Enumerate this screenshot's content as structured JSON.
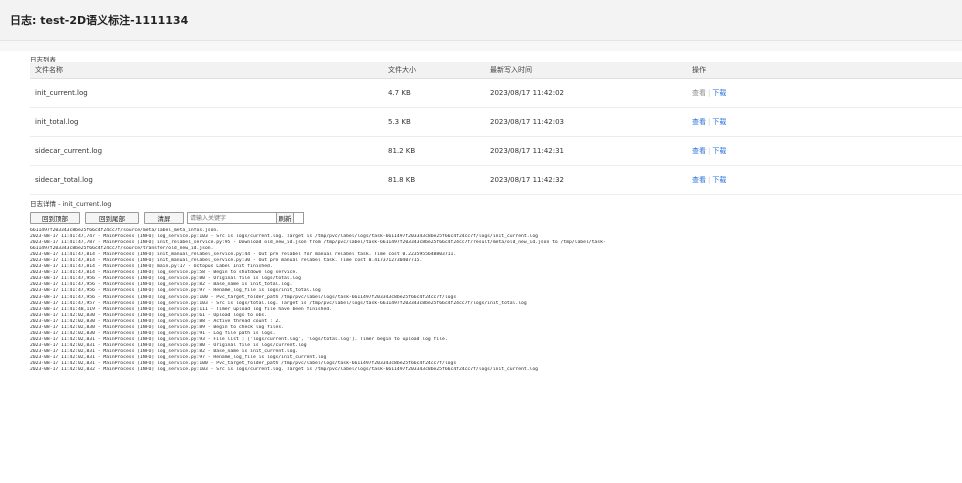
{
  "header": {
    "title": "日志: test-2D语义标注-1111134"
  },
  "log_list": {
    "label": "日志列表",
    "columns": [
      "文件名称",
      "文件大小",
      "最新写入时间",
      "操作"
    ],
    "rows": [
      {
        "name": "init_current.log",
        "size": "4.7 KB",
        "time": "2023/08/17 11:42:02",
        "view": "查看",
        "download": "下载"
      },
      {
        "name": "init_total.log",
        "size": "5.3 KB",
        "time": "2023/08/17 11:42:03",
        "view": "查看",
        "download": "下载"
      },
      {
        "name": "sidecar_current.log",
        "size": "81.2 KB",
        "time": "2023/08/17 11:42:31",
        "view": "查看",
        "download": "下载"
      },
      {
        "name": "sidecar_total.log",
        "size": "81.8 KB",
        "time": "2023/08/17 11:42:32",
        "view": "查看",
        "download": "下载"
      }
    ]
  },
  "log_detail": {
    "label": "日志详情 - init_current.log",
    "buttons": {
      "top": "回到顶部",
      "bottom": "回到尾部",
      "clear": "清屏",
      "refresh": "刷新"
    },
    "search_placeholder": "请输入关键字",
    "lines": [
      "6611497f203343c8be25f66c4f24cc7f/source/meta/label_meta_infos.json.",
      "2023-08-17 11:41:47,747 - MainProcess [INFO] log_service.py:103 - Src is logs/current.log. Target is /tmp/pvc/label/logs/task-6611497f203343c8be25f66c4f24cc7f/logs/init_current.log",
      "2023-08-17 11:41:47,787 - MainProcess [INFO] init_relabel_service.py:95 - Download old_new_id.json from /tmp/pvc/label/task-6611497f203343c8be25f66c4f24cc7f/result/meta/old_new_id.json to /tmp/label/task-",
      "6611497f203343c8be25f66c4f24cc7f/source/transfer/old_new_id.json.",
      "2023-08-17 11:41:47,814 - MainProcess [INFO] init_manual_relabel_service.py:44 - Out pre relabel for manual relabel task. Time cost 0.2235955648803711.",
      "2023-08-17 11:41:47,814 - MainProcess [INFO] init_manual_relabel_service.py:30 - Out pre manual relabel task. Time cost 0.4173712730407715.",
      "2023-08-17 11:41:47,814 - MainProcess [INFO] main.py:17 - Octopus Label Init finished.",
      "2023-08-17 11:41:47,814 - MainProcess [INFO] log_service.py:58 - Begin to shutdown log service.",
      "2023-08-17 11:41:47,956 - MainProcess [INFO] log_service.py:80 - Original file is logs/total.log",
      "2023-08-17 11:41:47,956 - MainProcess [INFO] log_service.py:82 - Base_name is init_total.log.",
      "2023-08-17 11:41:47,956 - MainProcess [INFO] log_service.py:97 - Rename_log_file is logs/init_total.log",
      "2023-08-17 11:41:47,956 - MainProcess [INFO] log_service.py:100 - Pvc_target_folder_path /tmp/pvc/label/logs/task-6611497f203343c8be25f66c4f24cc7f/logs",
      "2023-08-17 11:41:47,957 - MainProcess [INFO] log_service.py:103 - Src is logs/total.log. Target is /tmp/pvc/label/logs/task-6611497f203343c8be25f66c4f24cc7f/logs/init_total.log",
      "2023-08-17 11:41:48,119 - MainProcess [INFO] log_service.py:111 - Timer upload log file have been finished.",
      "2023-08-17 11:42:02,830 - MainProcess [INFO] log_service.py:61 - Upload logs to obs.",
      "2023-08-17 11:42:02,830 - MainProcess [INFO] log_service.py:88 - Active thread count : 2.",
      "2023-08-17 11:42:02,830 - MainProcess [INFO] log_service.py:89 - Begin to check log files.",
      "2023-08-17 11:42:02,830 - MainProcess [INFO] log_service.py:91 - Log file path is logs.",
      "2023-08-17 11:42:02,831 - MainProcess [INFO] log_service.py:93 - File list : ['logs/current.log', 'logs/total.log']. Timer begin to upload log file.",
      "2023-08-17 11:42:02,831 - MainProcess [INFO] log_service.py:80 - Original file is logs/current.log",
      "2023-08-17 11:42:02,831 - MainProcess [INFO] log_service.py:82 - Base_name is init_current.log.",
      "2023-08-17 11:42:02,831 - MainProcess [INFO] log_service.py:97 - Rename_log_file is logs/init_current.log",
      "2023-08-17 11:42:02,831 - MainProcess [INFO] log_service.py:100 - Pvc_target_folder_path /tmp/pvc/label/logs/task-6611497f203343c8be25f66c4f24cc7f/logs",
      "2023-08-17 11:42:02,832 - MainProcess [INFO] log_service.py:103 - Src is logs/current.log. Target is /tmp/pvc/label/logs/task-6611497f203343c8be25f66c4f24cc7f/logs/init_current.log"
    ]
  },
  "colors": {
    "link": "#2a6fdb",
    "link_disabled": "#8a8a8a"
  }
}
